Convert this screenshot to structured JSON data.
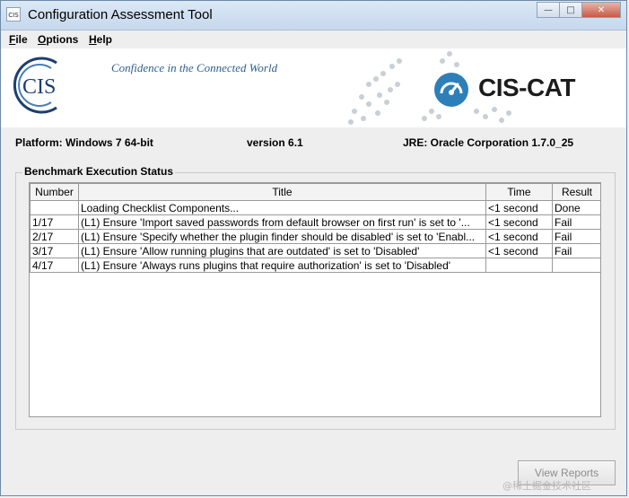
{
  "window": {
    "app_icon_text": "CIS",
    "title": "Configuration Assessment Tool",
    "buttons": [
      "minimize",
      "maximize",
      "close"
    ]
  },
  "menu": [
    {
      "label": "File",
      "mnemonic": "F",
      "rest": "ile"
    },
    {
      "label": "Options",
      "mnemonic": "O",
      "rest": "ptions"
    },
    {
      "label": "Help",
      "mnemonic": "H",
      "rest": "elp"
    }
  ],
  "banner": {
    "logo_text": "CIS",
    "tagline": "Confidence in the Connected World",
    "product": "CIS-CAT",
    "brand_blue": "#2e7fb8",
    "tagline_color": "#2c5f8f"
  },
  "info": {
    "platform": "Platform: Windows 7 64-bit",
    "version": "version 6.1",
    "jre": "JRE: Oracle Corporation 1.7.0_25"
  },
  "status": {
    "group_title": "Benchmark Execution Status",
    "columns": [
      "Number",
      "Title",
      "Time",
      "Result"
    ],
    "rows": [
      {
        "number": "",
        "title": "Loading Checklist Components...",
        "time": "<1 second",
        "result": "Done"
      },
      {
        "number": "1/17",
        "title": "(L1) Ensure 'Import saved passwords from default browser on first run' is set to '...",
        "time": "<1 second",
        "result": "Fail"
      },
      {
        "number": "2/17",
        "title": "(L1) Ensure 'Specify whether the plugin finder should be disabled' is set to 'Enabl...",
        "time": "<1 second",
        "result": "Fail"
      },
      {
        "number": "3/17",
        "title": "(L1) Ensure 'Allow running plugins that are outdated' is set to 'Disabled'",
        "time": "<1 second",
        "result": "Fail"
      },
      {
        "number": "4/17",
        "title": "(L1) Ensure 'Always runs plugins that require authorization' is set to 'Disabled'",
        "time": "",
        "result": ""
      }
    ]
  },
  "footer": {
    "view_reports": "View Reports",
    "watermark": "@稀土掘金技术社区"
  }
}
